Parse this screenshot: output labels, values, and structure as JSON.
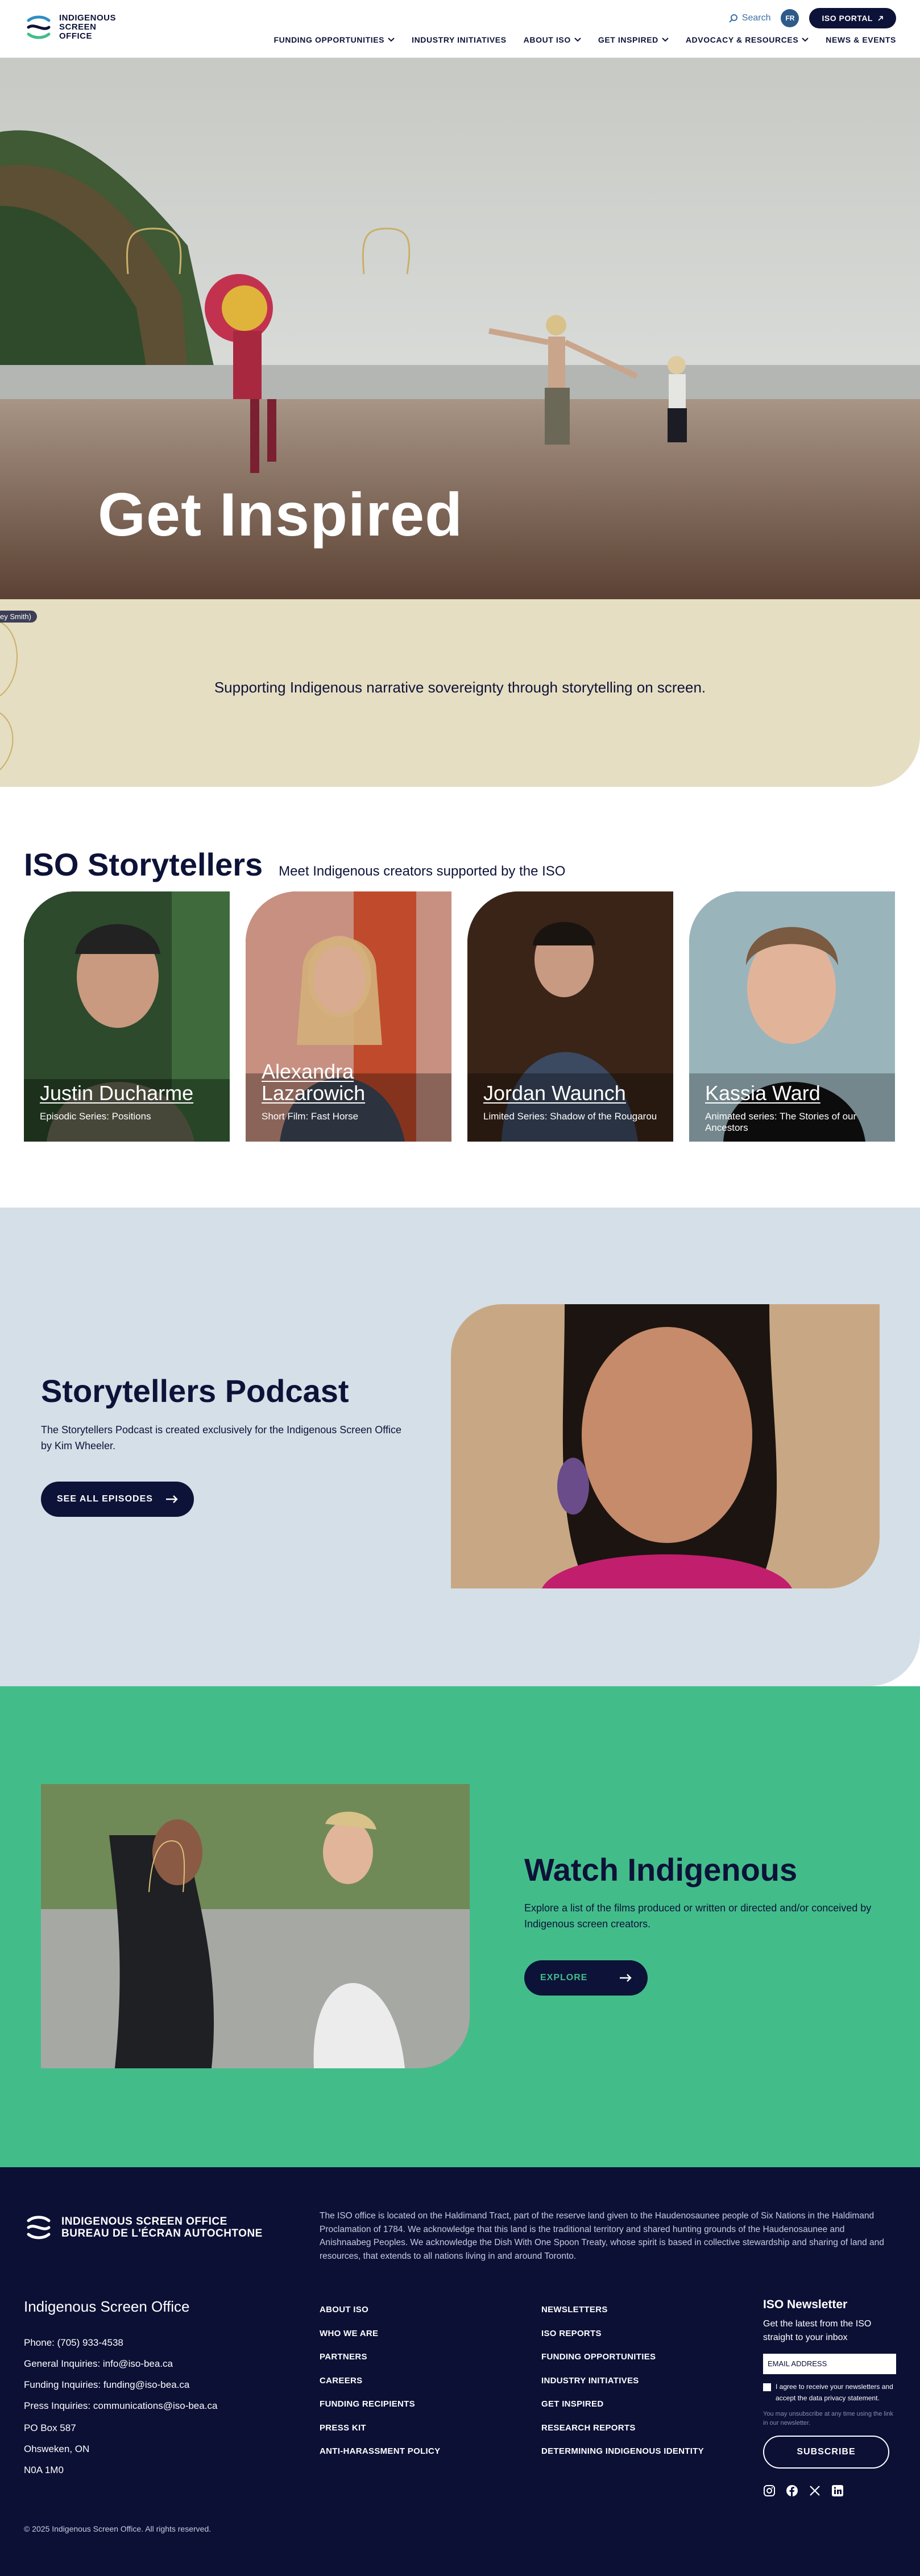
{
  "header": {
    "logo_lines": [
      "INDIGENOUS",
      "SCREEN",
      "OFFICE"
    ],
    "search_label": "Search",
    "lang_label": "FR",
    "portal_label": "ISO PORTAL",
    "nav": [
      {
        "label": "FUNDING OPPORTUNITIES",
        "dropdown": true
      },
      {
        "label": "INDUSTRY INITIATIVES",
        "dropdown": false
      },
      {
        "label": "ABOUT ISO",
        "dropdown": true
      },
      {
        "label": "GET INSPIRED",
        "dropdown": true
      },
      {
        "label": "ADVOCACY & RESOURCES",
        "dropdown": true
      },
      {
        "label": "NEWS & EVENTS",
        "dropdown": false
      }
    ]
  },
  "hero": {
    "title": "Get Inspired",
    "credit": "ey Smith)"
  },
  "intro": {
    "text": "Supporting Indigenous narrative sovereignty through storytelling on screen."
  },
  "storytellers": {
    "title": "ISO Storytellers",
    "subtitle": "Meet Indigenous creators supported by the ISO",
    "cards": [
      {
        "name": "Justin Ducharme",
        "desc": "Episodic Series: Positions"
      },
      {
        "name": "Alexandra Lazarowich",
        "desc": "Short Film: Fast Horse"
      },
      {
        "name": "Jordan Waunch",
        "desc": "Limited Series: Shadow of the Rougarou"
      },
      {
        "name": "Kassia Ward",
        "desc": "Animated series: The Stories of our Ancestors"
      }
    ]
  },
  "podcast": {
    "title": "Storytellers Podcast",
    "text": "The Storytellers Podcast is created exclusively for the Indigenous Screen Office by Kim Wheeler.",
    "button": "SEE ALL EPISODES"
  },
  "watch": {
    "title": "Watch Indigenous",
    "text": "Explore a list of the films produced or written or directed and/or conceived by Indigenous screen creators.",
    "button": "EXPLORE"
  },
  "footer": {
    "logo_line1": "INDIGENOUS SCREEN OFFICE",
    "logo_line2": "BUREAU DE L'ÉCRAN AUTOCHTONE",
    "acknowledgement": "The ISO office is located on the Haldimand Tract, part of the reserve land given to the Haudenosaunee people of Six Nations in the Haldimand Proclamation of 1784. We acknowledge that this land is the traditional territory and shared hunting grounds of the Haudenosaunee and Anishnaabeg Peoples. We acknowledge the Dish With One Spoon Treaty, whose spirit is based in collective stewardship and sharing of land and resources, that extends to all nations living in and around Toronto.",
    "org_name": "Indigenous Screen Office",
    "contact": [
      "Phone: (705) 933-4538",
      "General Inquiries: info@iso-bea.ca",
      "Funding Inquiries: funding@iso-bea.ca",
      "Press Inquiries: communications@iso-bea.ca"
    ],
    "address": [
      "PO Box 587",
      "Ohsweken, ON",
      "N0A 1M0"
    ],
    "col1": [
      "ABOUT ISO",
      "WHO WE ARE",
      "PARTNERS",
      "CAREERS",
      "FUNDING RECIPIENTS",
      "PRESS KIT",
      "ANTI-HARASSMENT POLICY"
    ],
    "col2": [
      "NEWSLETTERS",
      "ISO REPORTS",
      "FUNDING OPPORTUNITIES",
      "INDUSTRY INITIATIVES",
      "GET INSPIRED",
      "RESEARCH REPORTS",
      "DETERMINING INDIGENOUS IDENTITY"
    ],
    "newsletter": {
      "title": "ISO Newsletter",
      "lead": "Get the latest from the ISO straight to your inbox",
      "email_placeholder": "EMAIL ADDRESS",
      "consent": "I agree to receive your newsletters and accept the data privacy statement.",
      "fine": "You may unsubscribe at any time using the link in our newsletter.",
      "button": "SUBSCRIBE"
    },
    "social": [
      "instagram-icon",
      "facebook-icon",
      "x-icon",
      "linkedin-icon"
    ],
    "copyright": "© 2025 Indigenous Screen Office. All rights reserved."
  },
  "colors": {
    "navy": "#0d1238",
    "sand": "#e6dec2",
    "sky": "#d4dfe8",
    "green": "#42bd8a",
    "footer": "#0c1035"
  }
}
